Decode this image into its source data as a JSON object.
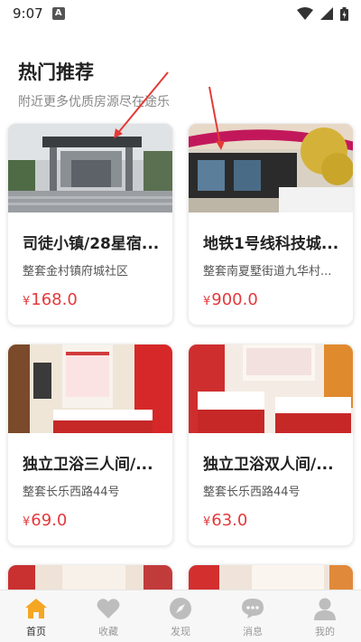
{
  "status": {
    "time": "9:07",
    "notif": "A"
  },
  "header": {
    "title": "热门推荐",
    "subtitle": "附近更多优质房源尽在途乐"
  },
  "listings": [
    {
      "title": "司徒小镇/28星宿...",
      "address": "整套金村镇府城社区",
      "currency": "¥",
      "price": "168.0"
    },
    {
      "title": "地铁1号线科技城...",
      "address": "整套南夏墅街道九华村...",
      "currency": "¥",
      "price": "900.0"
    },
    {
      "title": "独立卫浴三人间/...",
      "address": "整套长乐西路44号",
      "currency": "¥",
      "price": "69.0"
    },
    {
      "title": "独立卫浴双人间/...",
      "address": "整套长乐西路44号",
      "currency": "¥",
      "price": "63.0"
    }
  ],
  "tabbar": {
    "items": [
      {
        "label": "首页",
        "icon": "home-icon",
        "active": true
      },
      {
        "label": "收藏",
        "icon": "heart-icon",
        "active": false
      },
      {
        "label": "发现",
        "icon": "compass-icon",
        "active": false
      },
      {
        "label": "消息",
        "icon": "chat-icon",
        "active": false
      },
      {
        "label": "我的",
        "icon": "user-icon",
        "active": false
      }
    ]
  },
  "colors": {
    "accent": "#f5a623",
    "price": "#e4393c",
    "tab_inactive": "#bdbdbd"
  }
}
